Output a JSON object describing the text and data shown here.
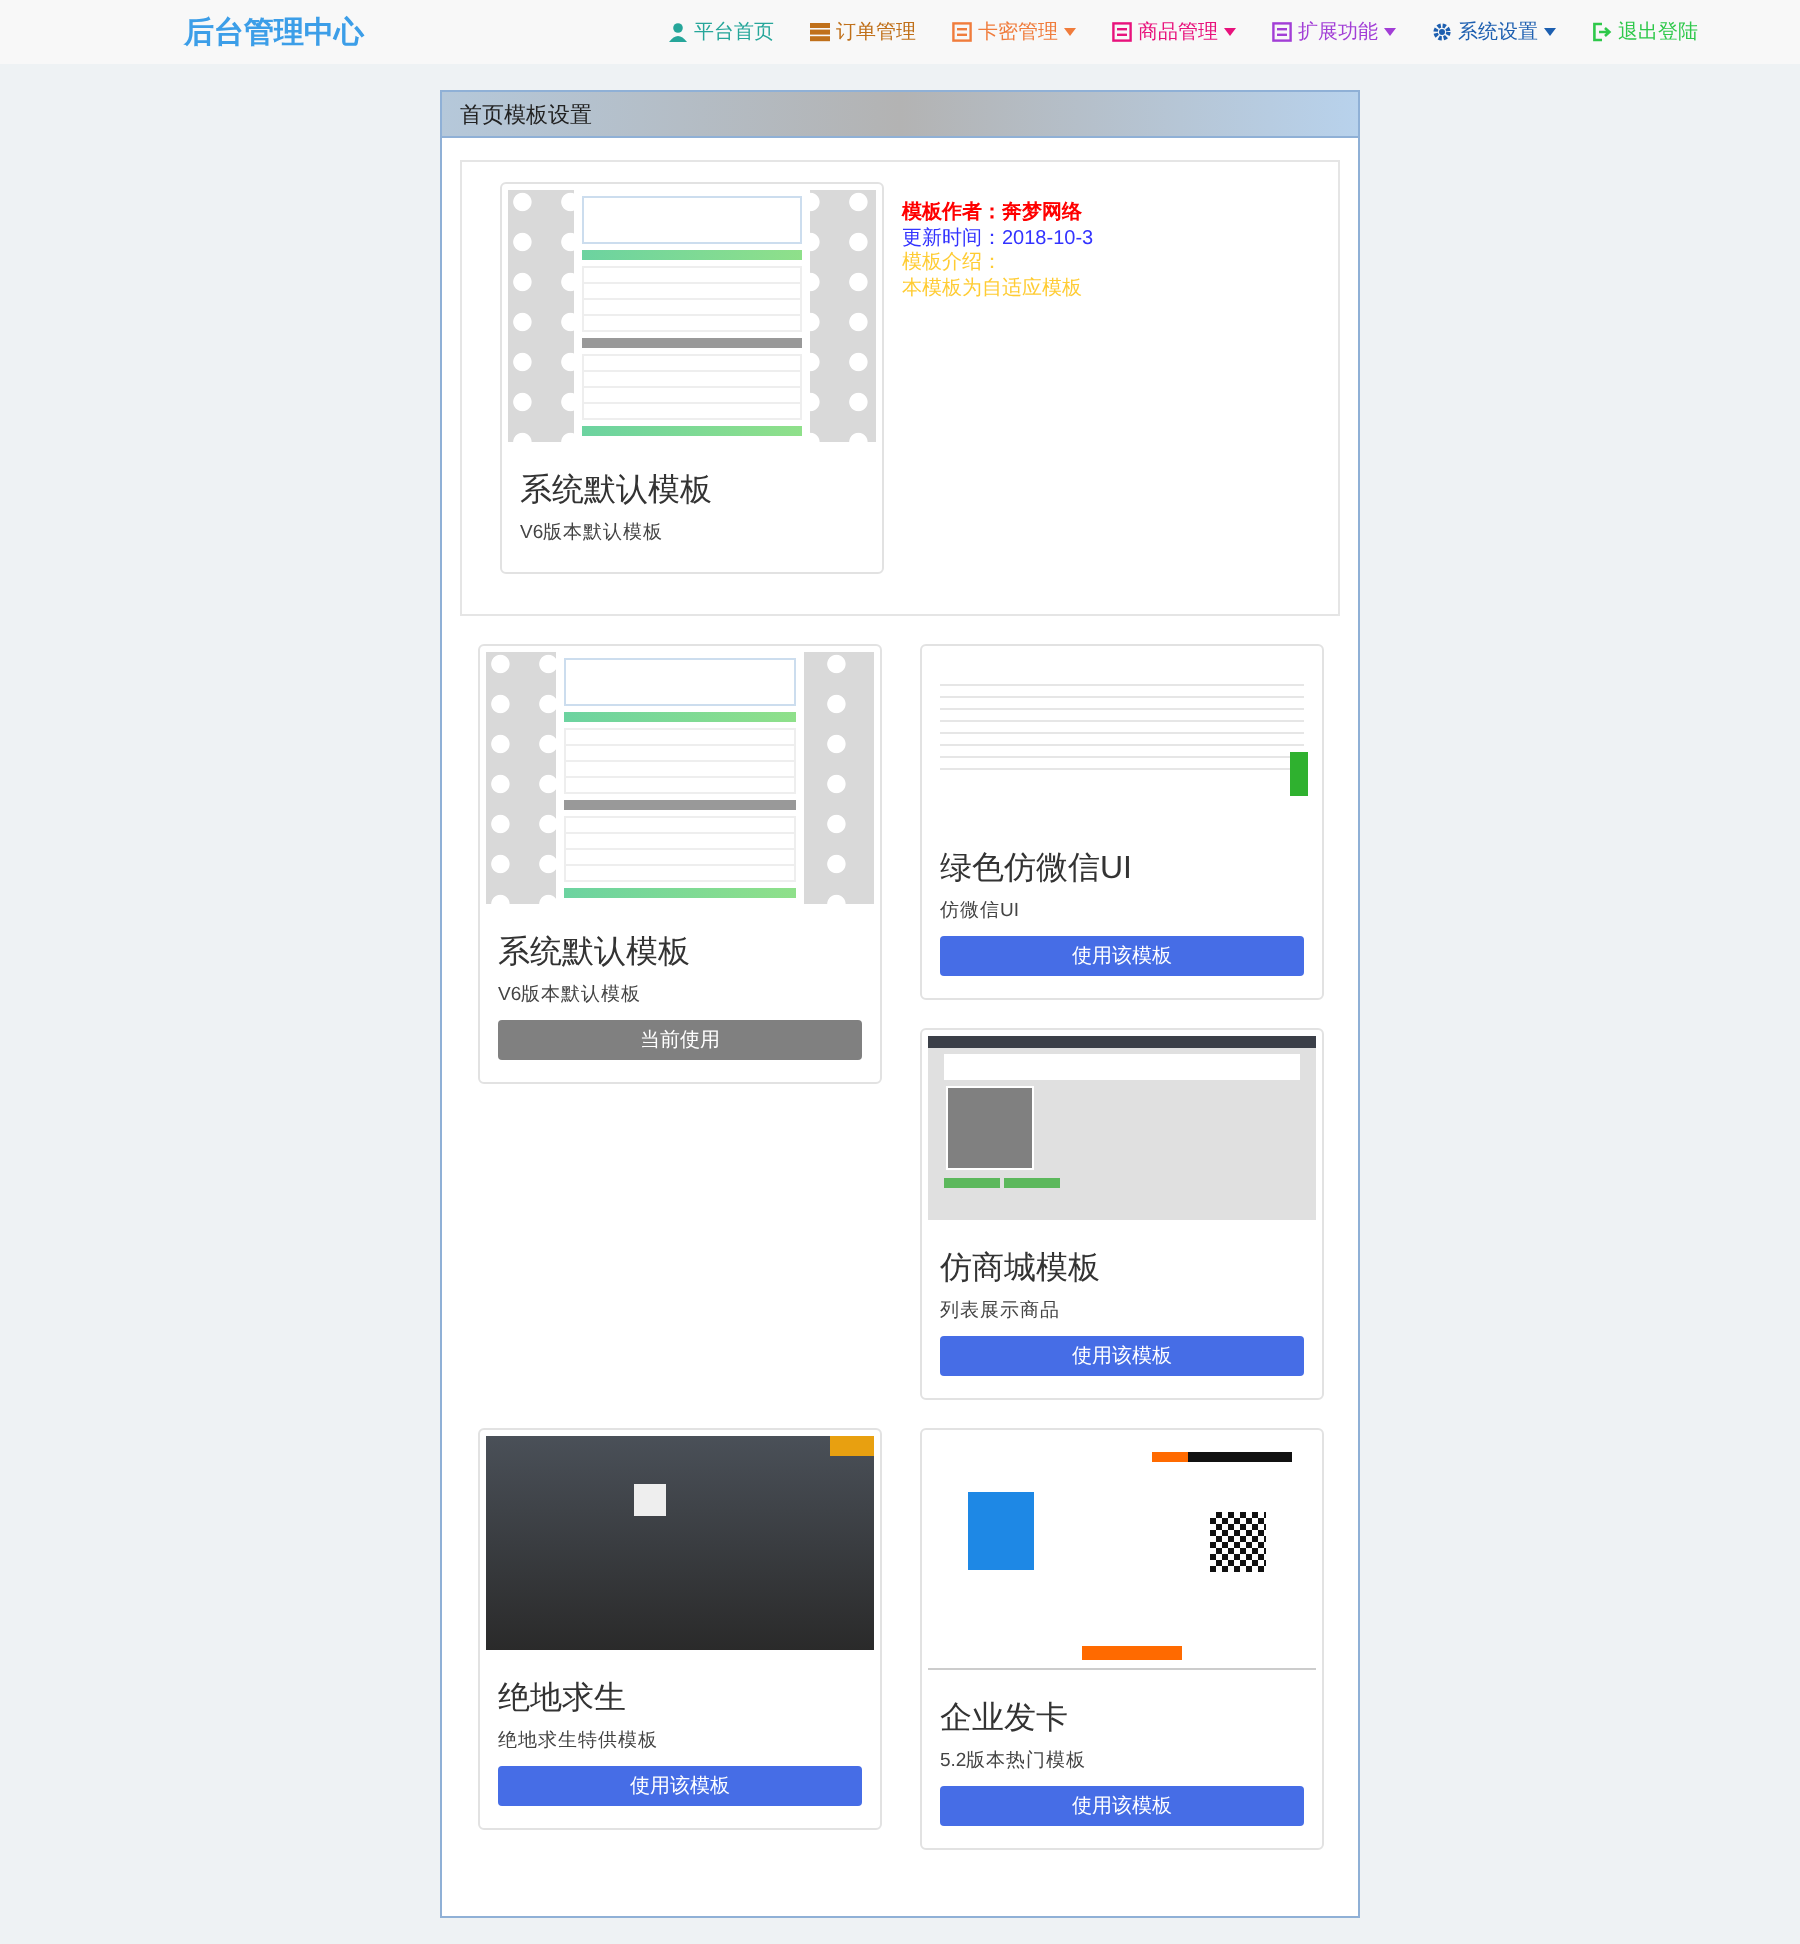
{
  "navbar": {
    "brand": "后台管理中心",
    "items": [
      {
        "label": "平台首页",
        "kind": "user",
        "color": "#26a69a",
        "has_dropdown": false
      },
      {
        "label": "订单管理",
        "kind": "list",
        "color": "#c0701a",
        "has_dropdown": false
      },
      {
        "label": "卡密管理",
        "kind": "card",
        "color": "#f07c3c",
        "has_dropdown": true
      },
      {
        "label": "商品管理",
        "kind": "card",
        "color": "#e8127c",
        "has_dropdown": true
      },
      {
        "label": "扩展功能",
        "kind": "card",
        "color": "#a23ed6",
        "has_dropdown": true
      },
      {
        "label": "系统设置",
        "kind": "gear",
        "color": "#1d5fb0",
        "has_dropdown": true
      },
      {
        "label": "退出登陆",
        "kind": "logout",
        "color": "#2ec84a",
        "has_dropdown": false
      }
    ]
  },
  "panel": {
    "title": "首页模板设置",
    "current": {
      "kind": "clouds",
      "name": "系统默认模板",
      "description": "V6版本默认模板",
      "info": [
        {
          "text": "模板作者：奔梦网络",
          "color": "#ff0000",
          "bold": true
        },
        {
          "text": "更新时间：2018-10-3",
          "color": "#3333ff",
          "bold": false
        },
        {
          "text": "模板介绍：",
          "color": "#ffcc33",
          "bold": false
        },
        {
          "text": "本模板为自适应模板",
          "color": "#ffcc33",
          "bold": false
        }
      ]
    },
    "templates": [
      {
        "kind": "clouds",
        "name": "系统默认模板",
        "description": "V6版本默认模板",
        "button": "当前使用",
        "in_use": true
      },
      {
        "kind": "wechat",
        "name": "绿色仿微信UI",
        "description": "仿微信UI",
        "button": "使用该模板",
        "in_use": false
      },
      {
        "kind": "shop",
        "name": "仿商城模板",
        "description": "列表展示商品",
        "button": "使用该模板",
        "in_use": false
      },
      {
        "kind": "game",
        "name": "绝地求生",
        "description": "绝地求生特供模板",
        "button": "使用该模板",
        "in_use": false
      },
      {
        "kind": "enterprise",
        "name": "企业发卡",
        "description": "5.2版本热门模板",
        "button": "使用该模板",
        "in_use": false
      }
    ]
  }
}
